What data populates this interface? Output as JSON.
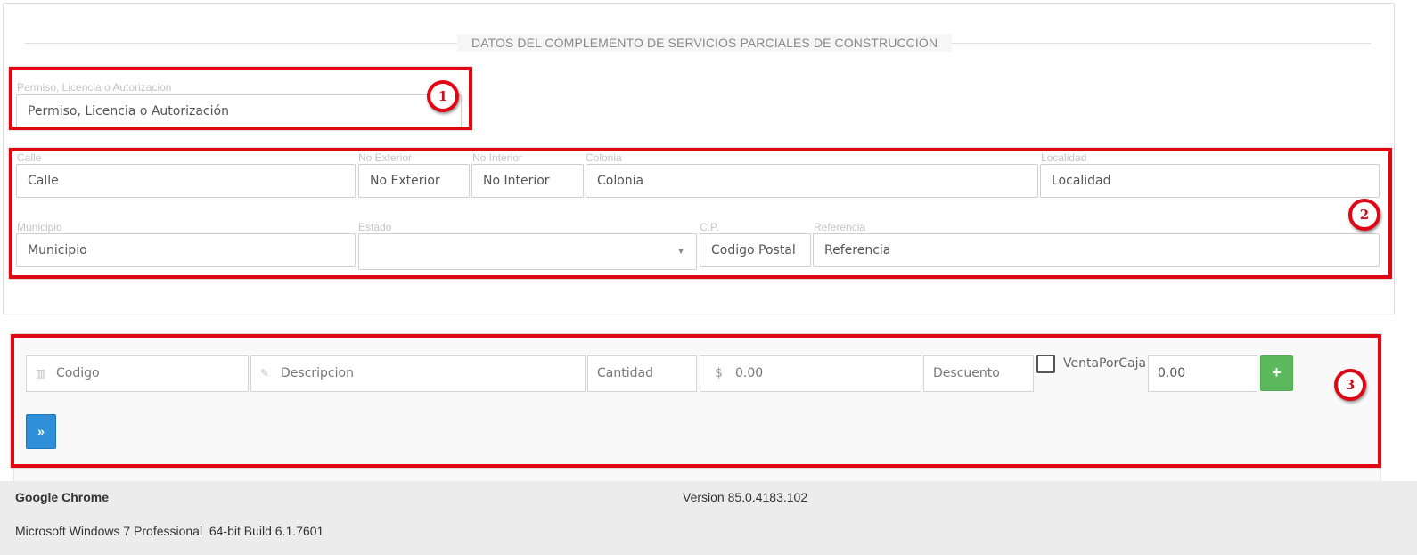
{
  "section": {
    "title": "DATOS DEL COMPLEMENTO DE SERVICIOS PARCIALES DE CONSTRUCCIÓN"
  },
  "permit": {
    "label": "Permiso, Licencia o Autorizacion",
    "placeholder": "Permiso, Licencia o Autorización"
  },
  "address": {
    "calle": {
      "label": "Calle",
      "placeholder": "Calle"
    },
    "no_exterior": {
      "label": "No Exterior",
      "placeholder": "No Exterior"
    },
    "no_interior": {
      "label": "No Interior",
      "placeholder": "No Interior"
    },
    "colonia": {
      "label": "Colonia",
      "placeholder": "Colonia"
    },
    "localidad": {
      "label": "Localidad",
      "placeholder": "Localidad"
    },
    "municipio": {
      "label": "Municipio",
      "placeholder": "Municipio"
    },
    "estado": {
      "label": "Estado",
      "value": ""
    },
    "cp": {
      "label": "C.P.",
      "placeholder": "Codigo Postal"
    },
    "referencia": {
      "label": "Referencia",
      "placeholder": "Referencia"
    }
  },
  "item_entry": {
    "codigo_placeholder": "Codigo",
    "descripcion_placeholder": "Descripcion",
    "cantidad_placeholder": "Cantidad",
    "precio_symbol": "$",
    "precio_placeholder": "0.00",
    "descuento_placeholder": "Descuento",
    "venta_por_caja_label": "VentaPorCaja",
    "total_value": "0.00",
    "add_label": "+",
    "next_label": "»"
  },
  "annotations": {
    "badge1": "1",
    "badge2": "2",
    "badge3": "3",
    "color": "#e10613"
  },
  "footer": {
    "browser": "Google Chrome",
    "version": "Version 85.0.4183.102",
    "os": "Microsoft Windows 7 Professional  64-bit Build 6.1.7601"
  }
}
